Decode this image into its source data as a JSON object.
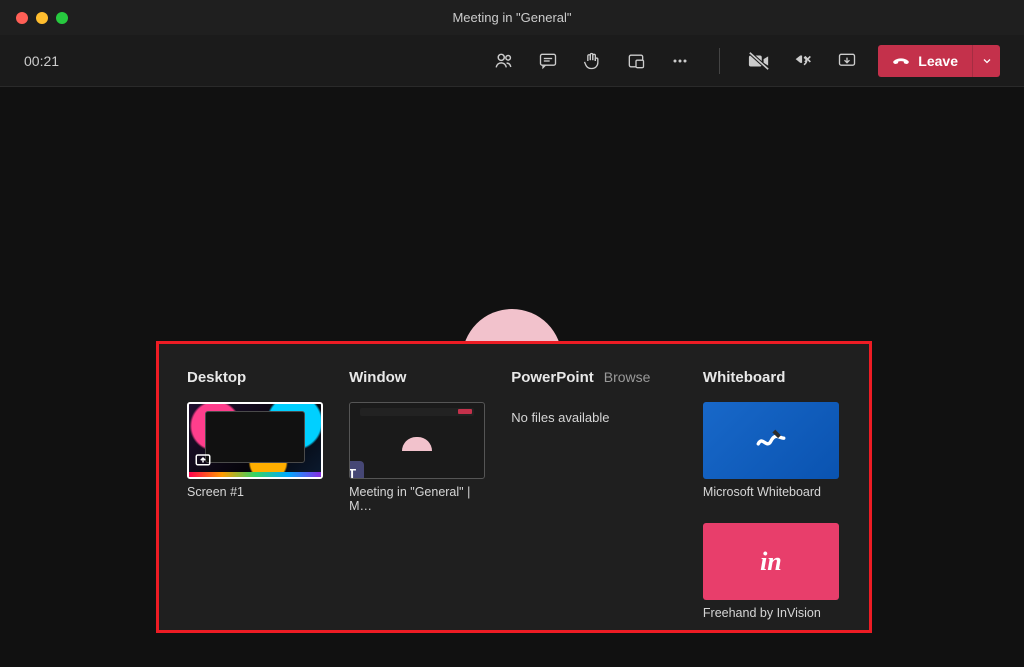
{
  "window_title": "Meeting in \"General\"",
  "meeting": {
    "timer": "00:21"
  },
  "toolbar": {
    "leave_label": "Leave"
  },
  "share_tray": {
    "desktop": {
      "heading": "Desktop",
      "items": [
        {
          "label": "Screen #1"
        }
      ]
    },
    "window": {
      "heading": "Window",
      "items": [
        {
          "label": "Meeting in \"General\" | M…"
        }
      ]
    },
    "powerpoint": {
      "heading": "PowerPoint",
      "browse_label": "Browse",
      "empty_label": "No files available"
    },
    "whiteboard": {
      "heading": "Whiteboard",
      "items": [
        {
          "label": "Microsoft Whiteboard"
        },
        {
          "label": "Freehand by InVision"
        }
      ]
    }
  }
}
